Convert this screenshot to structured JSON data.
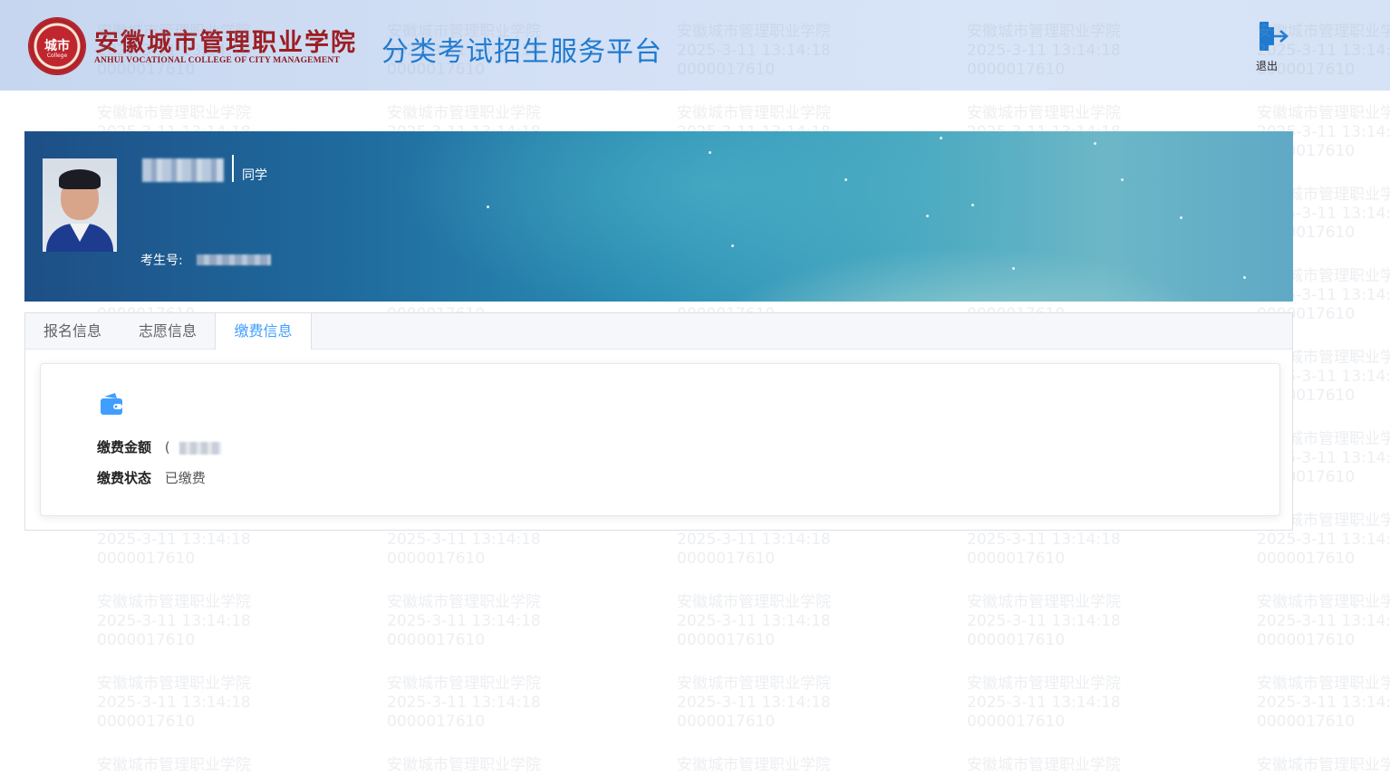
{
  "header": {
    "logo_seal_text": "城市",
    "logo_seal_sub": "College",
    "school_name_cn": "安徽城市管理职业学院",
    "school_name_en": "ANHUI VOCATIONAL COLLEGE OF CITY MANAGEMENT",
    "platform_title": "分类考试招生服务平台",
    "logout_label": "退出"
  },
  "watermark": {
    "line1": "安徽城市管理职业学院",
    "line2": "2025-3-11 13:14:18",
    "line3": "0000017610"
  },
  "profile": {
    "name_suffix": "同学",
    "exam_no_label": "考生号:"
  },
  "tabs": [
    {
      "label": "报名信息"
    },
    {
      "label": "志愿信息"
    },
    {
      "label": "缴费信息"
    }
  ],
  "payment": {
    "amount_label": "缴费金额",
    "amount_prefix": "(",
    "status_label": "缴费状态",
    "status_value": "已缴费"
  },
  "colors": {
    "accent": "#409eff",
    "title_blue": "#1f7ad0",
    "brand_red": "#9c1d22"
  }
}
